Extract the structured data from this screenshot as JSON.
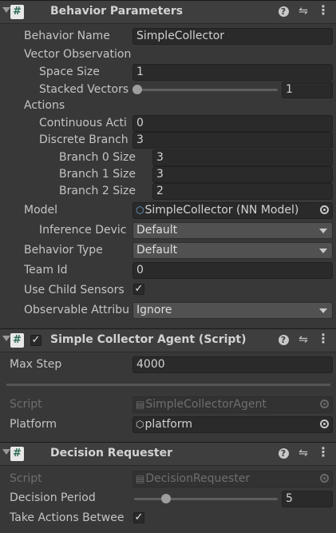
{
  "behavior_parameters": {
    "title": "Behavior Parameters",
    "behavior_name": {
      "label": "Behavior Name",
      "value": "SimpleCollector"
    },
    "vector_observation": {
      "label": "Vector Observation",
      "space_size": {
        "label": "Space Size",
        "value": "1"
      },
      "stacked_vectors": {
        "label": "Stacked Vectors",
        "value": "1"
      }
    },
    "actions": {
      "label": "Actions",
      "continuous": {
        "label": "Continuous Acti",
        "value": "0"
      },
      "discrete": {
        "label": "Discrete Branch",
        "value": "3"
      },
      "branches": [
        {
          "label": "Branch 0 Size",
          "value": "3"
        },
        {
          "label": "Branch 1 Size",
          "value": "3"
        },
        {
          "label": "Branch 2 Size",
          "value": "2"
        }
      ]
    },
    "model": {
      "label": "Model",
      "value": "SimpleCollector (NN Model)"
    },
    "inference_device": {
      "label": "Inference Devic",
      "value": "Default"
    },
    "behavior_type": {
      "label": "Behavior Type",
      "value": "Default"
    },
    "team_id": {
      "label": "Team Id",
      "value": "0"
    },
    "use_child_sensors": {
      "label": "Use Child Sensors",
      "checked": true
    },
    "observable_attributes": {
      "label": "Observable Attribu",
      "value": "Ignore"
    }
  },
  "agent_component": {
    "title": "Simple Collector Agent (Script)",
    "enabled": true,
    "max_step": {
      "label": "Max Step",
      "value": "4000"
    },
    "script": {
      "label": "Script",
      "value": "SimpleCollectorAgent"
    },
    "platform": {
      "label": "Platform",
      "value": "platform"
    }
  },
  "decision_requester": {
    "title": "Decision Requester",
    "script": {
      "label": "Script",
      "value": "DecisionRequester"
    },
    "decision_period": {
      "label": "Decision Period",
      "value": "5"
    },
    "take_actions": {
      "label": "Take Actions Betwee",
      "checked": true
    }
  },
  "icons": {
    "script": "script-hash-icon",
    "help": "help-icon",
    "presets": "presets-sliders-icon",
    "menu": "kebab-menu-icon",
    "model": "nn-model-icon",
    "gameobject": "gameobject-cube-icon"
  },
  "colors": {
    "background": "#383838",
    "header": "#3e3e3e",
    "field": "#2a2a2a",
    "dropdown": "#515151"
  }
}
